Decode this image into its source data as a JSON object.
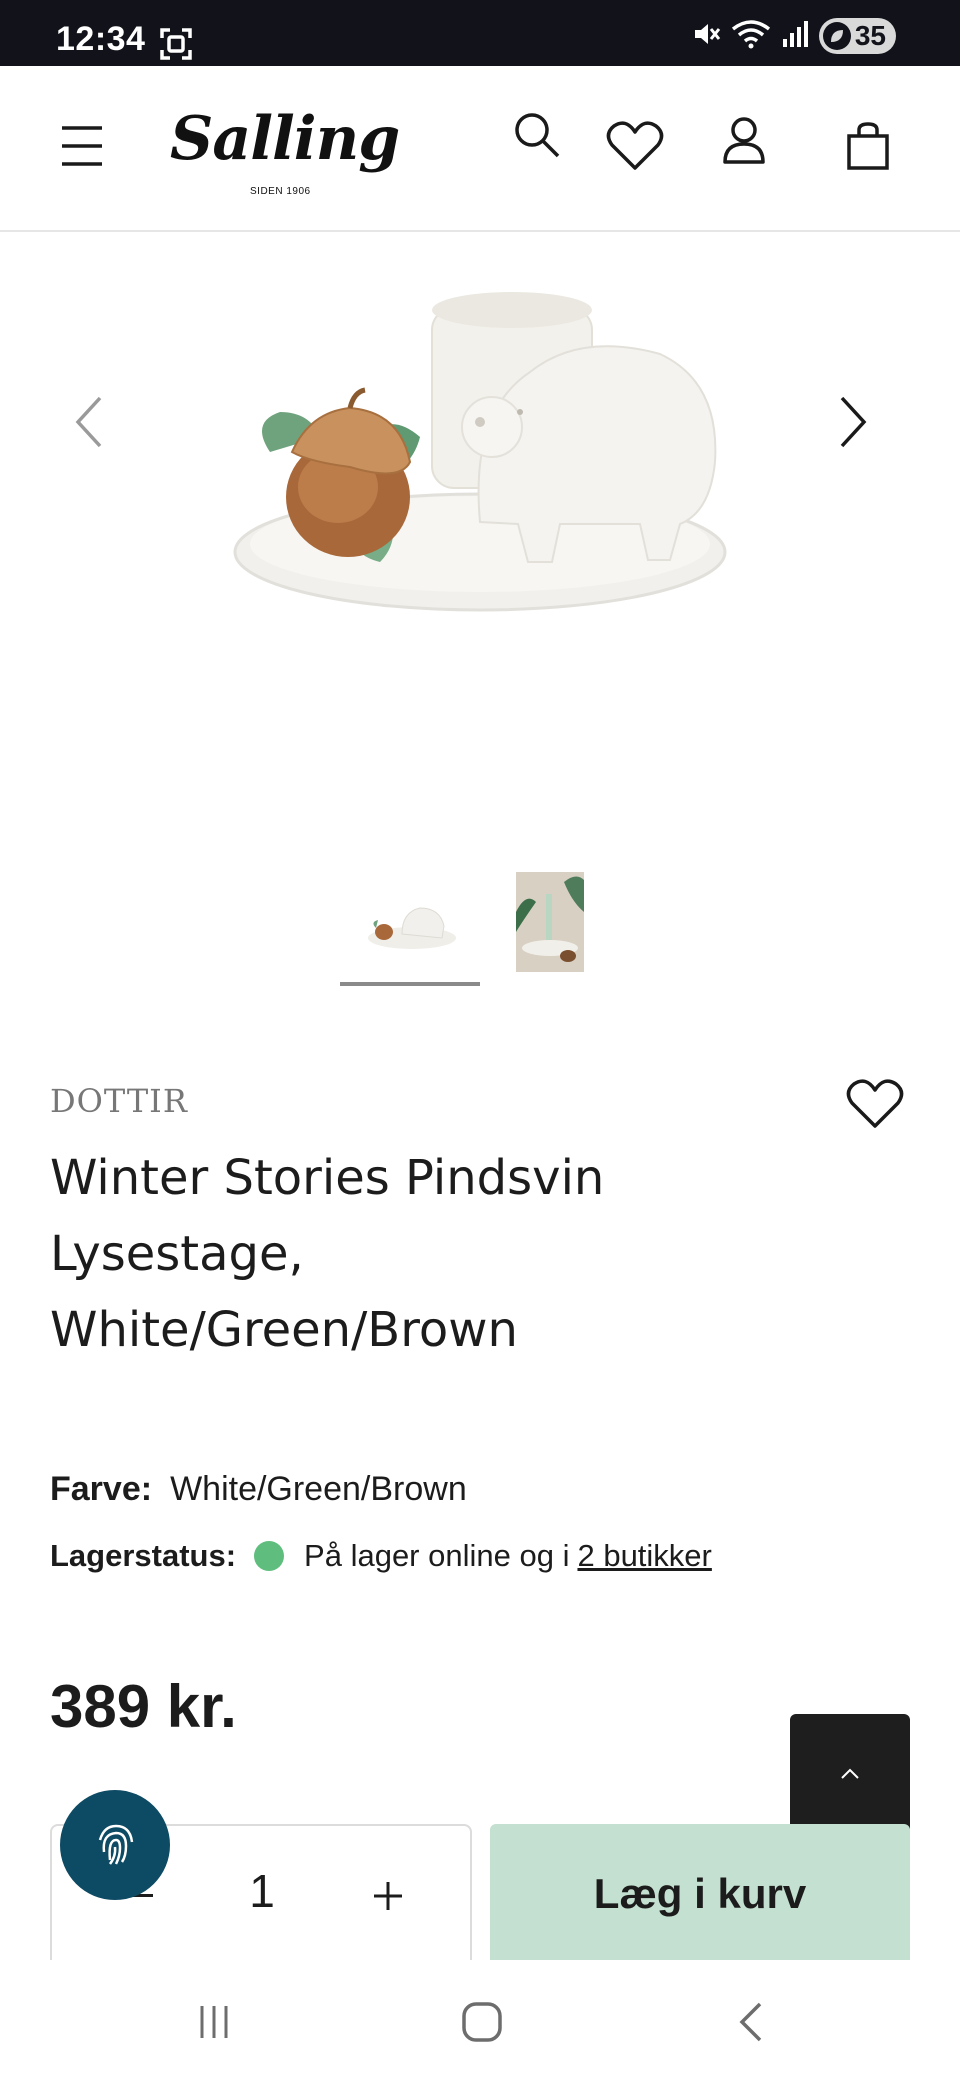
{
  "status_bar": {
    "time": "12:34",
    "battery": "35"
  },
  "header": {
    "logo_text": "Salling",
    "logo_sub": "SIDEN 1906"
  },
  "gallery": {
    "thumbnail_count": 2,
    "selected_index": 0
  },
  "product": {
    "brand": "DOTTIR",
    "title_line1": "Winter Stories Pindsvin",
    "title_line2": "Lysestage,",
    "title_line3": "White/Green/Brown",
    "color_label": "Farve:",
    "color_value": "White/Green/Brown",
    "stock_label": "Lagerstatus:",
    "stock_text": "På lager online og i",
    "stock_link": "2 butikker",
    "stock_status_color": "#5fbe7d",
    "price": "389 kr."
  },
  "cart": {
    "quantity": "1",
    "add_label": "Læg i kurv",
    "button_color": "#c3e0d0"
  },
  "colors": {
    "status_bar": "#12131a",
    "fingerprint_button": "#0d4a63",
    "to_top_button": "#1e1e1e"
  }
}
